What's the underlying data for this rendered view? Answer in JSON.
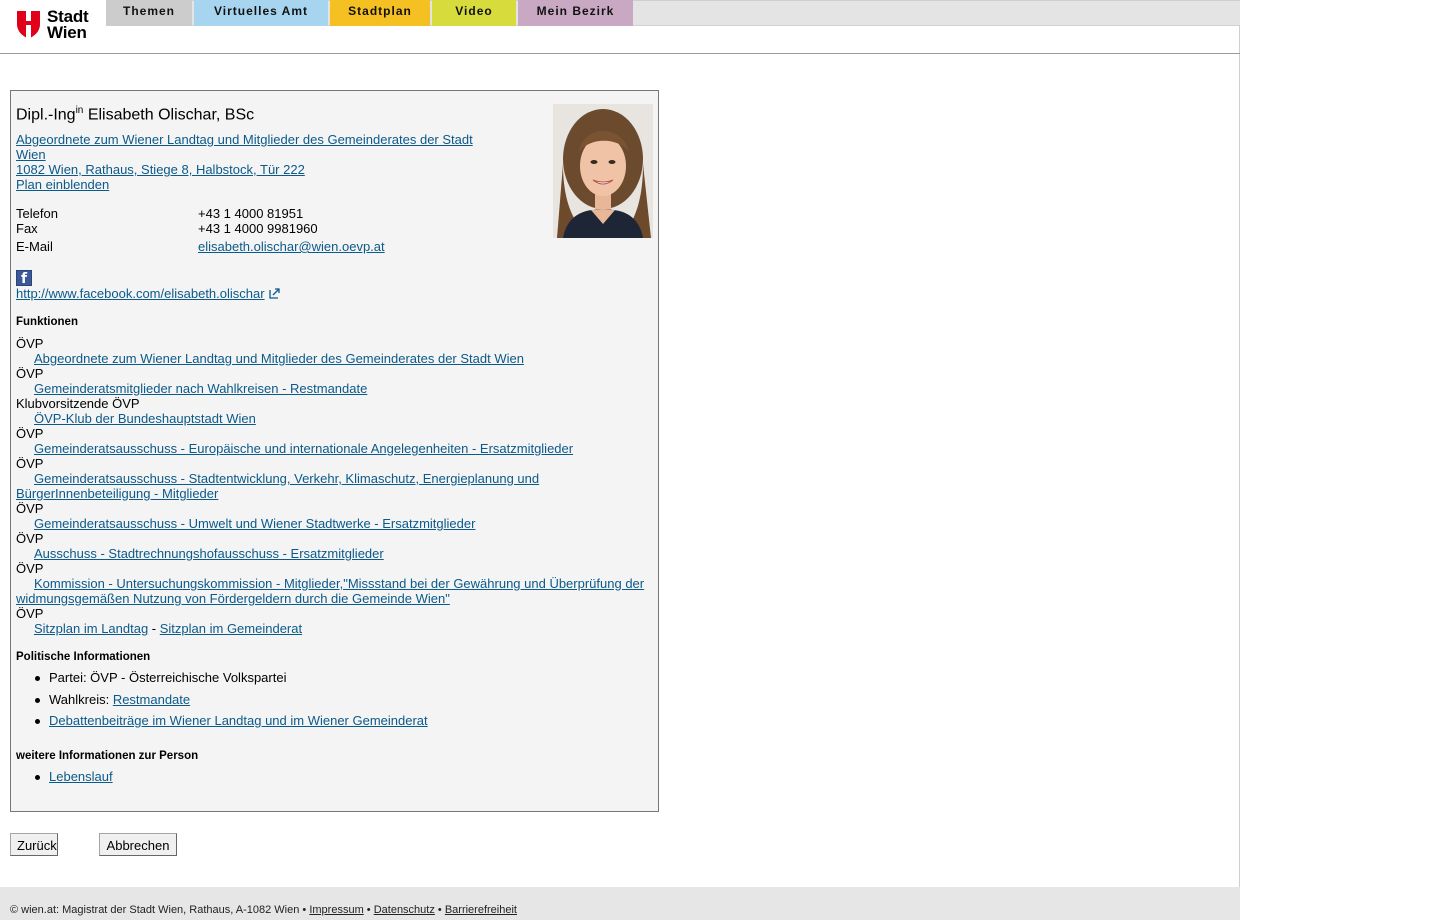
{
  "header": {
    "logo_line1": "Stadt",
    "logo_line2": "Wien",
    "tabs": [
      {
        "label": "Themen",
        "color": "#cccccc"
      },
      {
        "label": "Virtuelles Amt",
        "color": "#a7d5ef"
      },
      {
        "label": "Stadtplan",
        "color": "#f5c021"
      },
      {
        "label": "Video",
        "color": "#d7dc3c"
      },
      {
        "label": "Mein Bezirk",
        "color": "#c9a8c4"
      }
    ]
  },
  "person": {
    "title_prefix": "Dipl.-Ing",
    "title_sup": "in",
    "name": " Elisabeth Olischar, BSc",
    "role_line1": "Abgeordnete zum Wiener Landtag und Mitglieder des Gemeinderates der Stadt",
    "role_line2": "Wien",
    "address": "1082 Wien, Rathaus, Stiege 8, Halbstock, Tür 222",
    "plan_link": "Plan einblenden",
    "contact": {
      "phone_label": "Telefon",
      "phone": "+43 1 4000 81951",
      "fax_label": "Fax",
      "fax": "+43 1 4000 9981960",
      "email_label": "E-Mail",
      "email": "elisabeth.olischar@wien.oevp.at"
    },
    "facebook_url": "http://www.facebook.com/elisabeth.olischar"
  },
  "funktionen": {
    "heading": "Funktionen",
    "items": [
      {
        "party": "ÖVP",
        "link": "Abgeordnete zum Wiener Landtag und Mitglieder des Gemeinderates der Stadt Wien"
      },
      {
        "party": "ÖVP",
        "link": "Gemeinderatsmitglieder nach Wahlkreisen - Restmandate"
      },
      {
        "party": "Klubvorsitzende ÖVP",
        "link": "ÖVP-Klub der Bundeshauptstadt Wien"
      },
      {
        "party": "ÖVP",
        "link": "Gemeinderatsausschuss - Europäische und internationale Angelegenheiten - Ersatzmitglieder"
      },
      {
        "party": "ÖVP",
        "link_line1": "Gemeinderatsausschuss - Stadtentwicklung, Verkehr, Klimaschutz, Energieplanung und",
        "link_line2": "BürgerInnenbeteiligung - Mitglieder"
      },
      {
        "party": "ÖVP",
        "link": "Gemeinderatsausschuss - Umwelt und Wiener Stadtwerke - Ersatzmitglieder"
      },
      {
        "party": "ÖVP",
        "link": "Ausschuss - Stadtrechnungshofausschuss - Ersatzmitglieder"
      },
      {
        "party": "ÖVP",
        "link_line1": "Kommission - Untersuchungskommission - Mitglieder,\"Missstand bei der Gewährung und Überprüfung der",
        "link_line2": "widmungsgemäßen Nutzung von Fördergeldern durch die Gemeinde Wien\""
      },
      {
        "party": "ÖVP",
        "link_a": "Sitzplan im Landtag",
        "sep": " - ",
        "link_b": "Sitzplan im Gemeinderat"
      }
    ]
  },
  "politik": {
    "heading": "Politische Informationen",
    "partei": "Partei: ÖVP - Österreichische Volkspartei",
    "wahlkreis_label": "Wahlkreis: ",
    "wahlkreis_link": "Restmandate",
    "debatten_link": "Debattenbeiträge im Wiener Landtag und im Wiener Gemeinderat"
  },
  "weitere": {
    "heading": "weitere Informationen zur Person",
    "lebenslauf_link": "Lebenslauf"
  },
  "buttons": {
    "back": "Zurück",
    "cancel": "Abbrechen"
  },
  "footer": {
    "text": "© wien.at: Magistrat der Stadt Wien, Rathaus, A-1082 Wien • ",
    "impressum": "Impressum",
    "sep1": " • ",
    "datenschutz": "Datenschutz",
    "sep2": " • ",
    "barrierefreiheit": "Barrierefreiheit"
  }
}
